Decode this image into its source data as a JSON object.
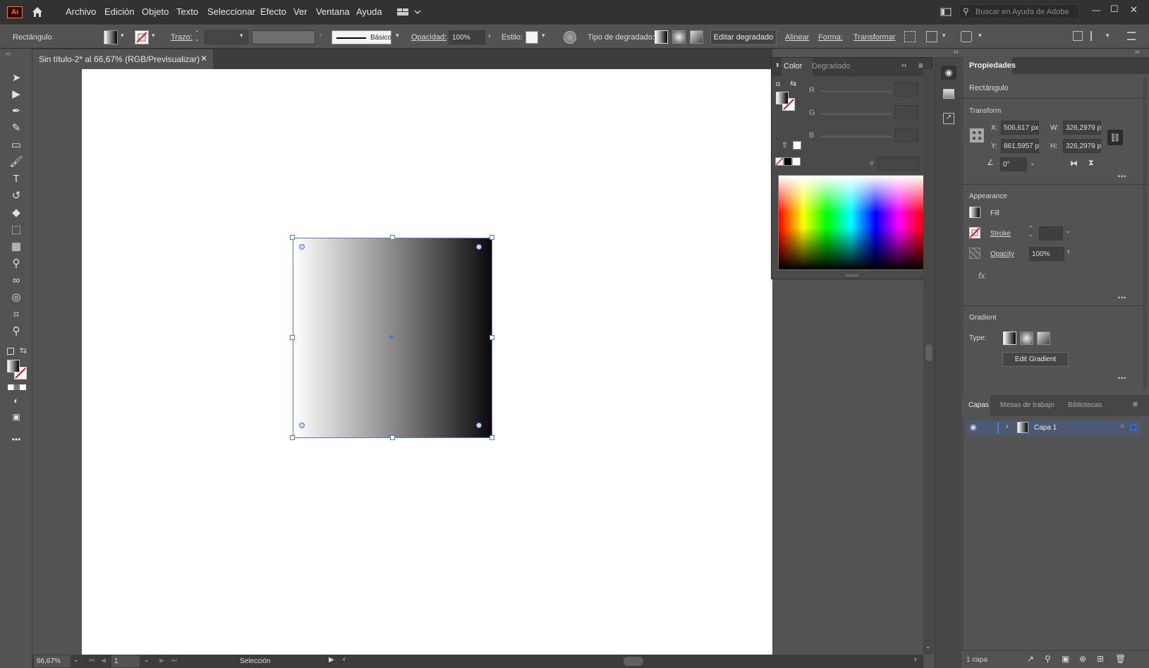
{
  "app": {
    "logo": "Ai"
  },
  "menu": {
    "items": [
      "Archivo",
      "Edición",
      "Objeto",
      "Texto",
      "Seleccionar",
      "Efecto",
      "Ver",
      "Ventana",
      "Ayuda"
    ]
  },
  "search": {
    "placeholder": "Buscar en Ayuda de Adobe"
  },
  "window_controls": {
    "minimize": "—",
    "maximize": "☐",
    "close": "✕"
  },
  "control_bar": {
    "object_type": "Rectángulo",
    "trazo_label": "Trazo:",
    "stroke_profile": "Básico",
    "opacidad_label": "Opacidad:",
    "opacidad_value": "100%",
    "estilo_label": "Estilo:",
    "gradient_type_label": "Tipo de degradado:",
    "edit_gradient_button": "Editar degradado",
    "alinear": "Alinear",
    "forma": "Forma:",
    "transformar": "Transformar"
  },
  "document": {
    "tab_title": "Sin título-2* al 66,67% (RGB/Previsualizar)"
  },
  "color_panel": {
    "tabs": [
      "Color",
      "Degradado"
    ],
    "channels": [
      "R",
      "G",
      "B"
    ],
    "hex_symbol": "#"
  },
  "properties": {
    "tabs": [
      "Propiedades"
    ],
    "object_type": "Rectángulo",
    "transform": {
      "title": "Transform",
      "x_label": "X:",
      "x_value": "506,617 px",
      "y_label": "Y:",
      "y_value": "861,5957 p",
      "w_label": "W:",
      "w_value": "326,2979 p",
      "h_label": "H:",
      "h_value": "326,2979 p",
      "angle_value": "0°"
    },
    "appearance": {
      "title": "Appearance",
      "fill": "Fill",
      "stroke": "Stroke",
      "opacity": "Opacity",
      "opacity_value": "100%",
      "fx": "fx."
    },
    "gradient": {
      "title": "Gradient",
      "type_label": "Type:",
      "edit_button": "Edit Gradient"
    },
    "more": "•••"
  },
  "layers": {
    "tabs": [
      "Capas",
      "Mesas de trabajo",
      "Bibliotecas"
    ],
    "layer_name": "Capa 1",
    "count": "1 capa"
  },
  "status": {
    "zoom": "66,67%",
    "artboard_number": "1",
    "tool": "Selección"
  },
  "colors": {
    "ui_dark": "#323232",
    "ui_mid": "#535353",
    "selection_blue": "#4a7bd8",
    "logo_orange": "#ff7c00",
    "layer_highlight": "#4b5a72"
  }
}
